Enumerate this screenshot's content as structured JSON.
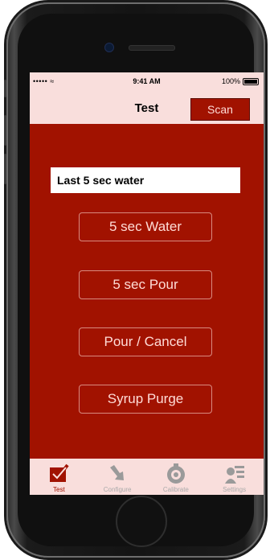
{
  "status_bar": {
    "signal": "•••••",
    "time": "9:41 AM",
    "battery": "100%"
  },
  "nav": {
    "title": "Test",
    "scan_label": "Scan"
  },
  "status_field": {
    "value": "Last 5 sec water"
  },
  "actions": [
    {
      "label": "5 sec Water"
    },
    {
      "label": "5 sec Pour"
    },
    {
      "label": "Pour / Cancel"
    },
    {
      "label": "Syrup Purge"
    }
  ],
  "tabs": [
    {
      "label": "Test",
      "icon": "checkmark-box-icon",
      "active": true
    },
    {
      "label": "Configure",
      "icon": "configure-arrow-icon",
      "active": false
    },
    {
      "label": "Calibrate",
      "icon": "calibrate-dial-icon",
      "active": false
    },
    {
      "label": "Settings",
      "icon": "settings-user-icon",
      "active": false
    }
  ],
  "colors": {
    "brand": "#a11200",
    "bar_background": "#f9dedc",
    "button_text": "#ffdcd6"
  }
}
